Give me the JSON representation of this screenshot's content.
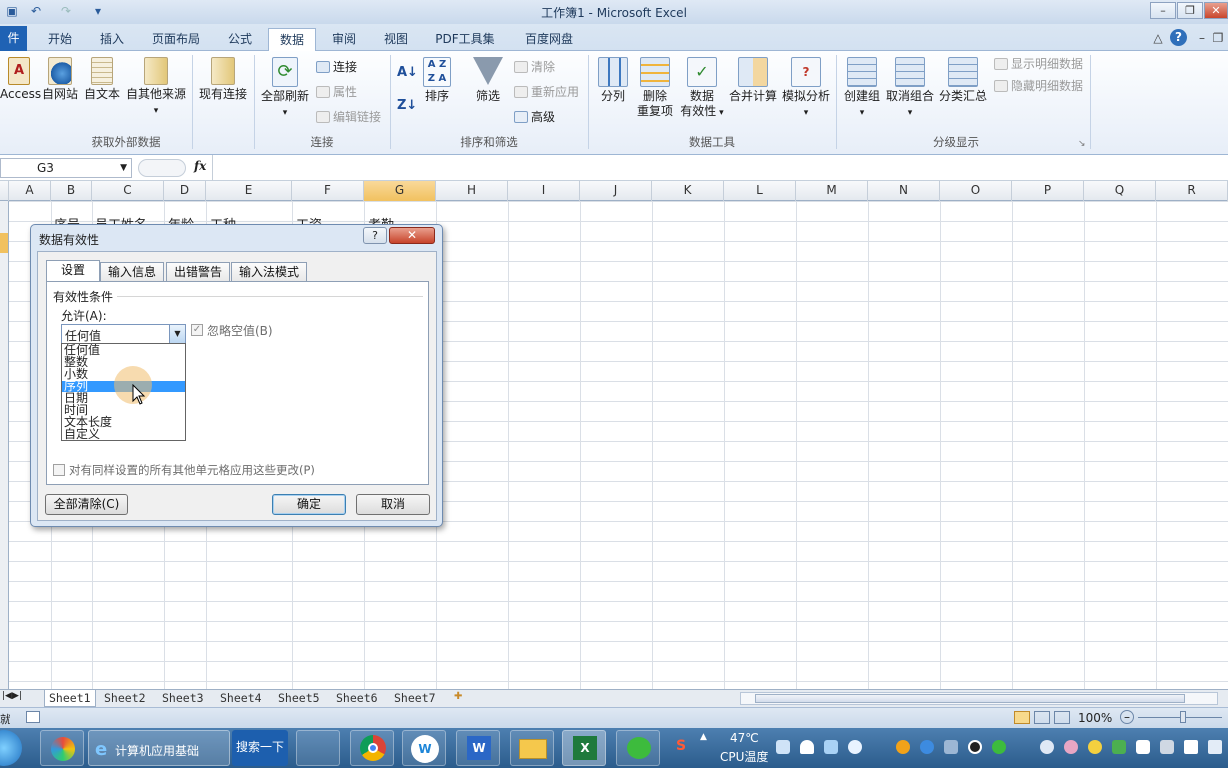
{
  "window": {
    "title": "工作簿1 - Microsoft Excel"
  },
  "tabs": [
    "件",
    "开始",
    "插入",
    "页面布局",
    "公式",
    "数据",
    "审阅",
    "视图",
    "PDF工具集",
    "百度网盘"
  ],
  "ribbon": {
    "groups": {
      "external": "获取外部数据",
      "connections": "连接",
      "sort": "排序和筛选",
      "tools": "数据工具",
      "outline": "分级显示"
    },
    "buttons": {
      "access": "Access",
      "web": "自网站",
      "text": "自文本",
      "other": "自其他来源",
      "existing": "现有连接",
      "refresh_all": "全部刷新",
      "connections": "连接",
      "properties": "属性",
      "edit_links": "编辑链接",
      "sort": "排序",
      "filter": "筛选",
      "clear": "清除",
      "reapply": "重新应用",
      "advanced": "高级",
      "split": "分列",
      "remove_dup_1": "删除",
      "remove_dup_2": "重复项",
      "validation_1": "数据",
      "validation_2": "有效性",
      "consolidate": "合并计算",
      "whatif": "模拟分析",
      "group": "创建组",
      "ungroup": "取消组合",
      "subtotal": "分类汇总",
      "show_detail": "显示明细数据",
      "hide_detail": "隐藏明细数据"
    }
  },
  "formula_bar": {
    "name_box": "G3",
    "fx": "fx",
    "formula": ""
  },
  "columns": [
    "A",
    "B",
    "C",
    "D",
    "E",
    "F",
    "G",
    "H",
    "I",
    "J",
    "K",
    "L",
    "M",
    "N",
    "O",
    "P",
    "Q",
    "R"
  ],
  "row1": {
    "B": "序号",
    "C": "员工姓名",
    "D": "年龄",
    "E": "工种",
    "F": "工资",
    "G": "考勤"
  },
  "sheets": [
    "Sheet1",
    "Sheet2",
    "Sheet3",
    "Sheet4",
    "Sheet5",
    "Sheet6",
    "Sheet7"
  ],
  "status": {
    "left": "就绪",
    "zoom": "100%"
  },
  "dialog": {
    "title": "数据有效性",
    "help": "?",
    "tabs": [
      "设置",
      "输入信息",
      "出错警告",
      "输入法模式"
    ],
    "section": "有效性条件",
    "allow_label": "允许(A):",
    "allow_value": "任何值",
    "ignore_blank": "忽略空值(B)",
    "options": [
      "任何值",
      "整数",
      "小数",
      "序列",
      "日期",
      "时间",
      "文本长度",
      "自定义"
    ],
    "highlighted_option": "序列",
    "apply_all": "对有同样设置的所有其他单元格应用这些更改(P)",
    "clear_all": "全部清除(C)",
    "ok": "确定",
    "cancel": "取消"
  },
  "taskbar": {
    "ie_label": "计算机应用基础",
    "search_label": "搜索一下",
    "temp": "47℃",
    "cpu": "CPU温度"
  },
  "colors": {
    "accent": "#1f62b4",
    "selection": "#3399ff",
    "header_selected": "#f1c15f"
  }
}
